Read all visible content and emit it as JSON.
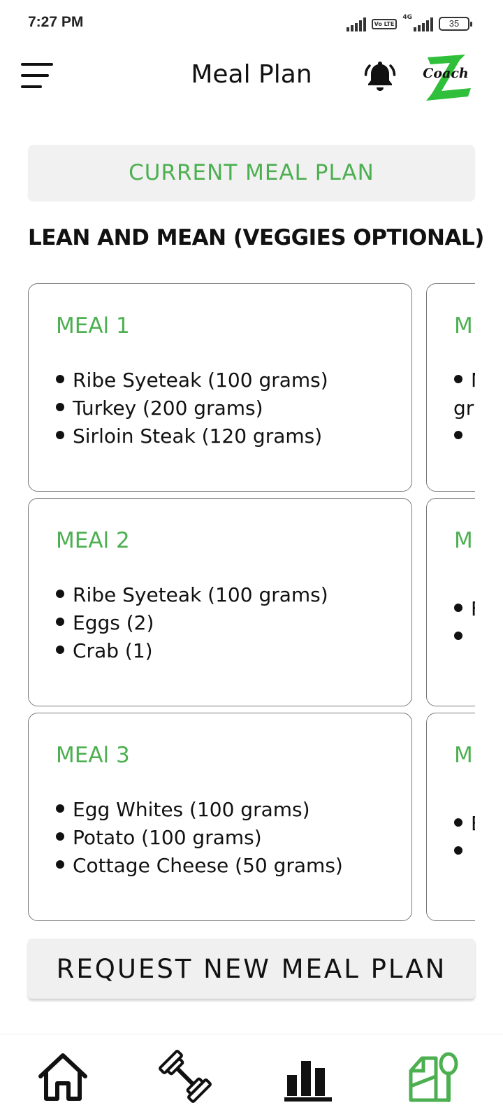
{
  "status_bar": {
    "time": "7:27 PM",
    "volte_label": "Vo LTE",
    "network_type": "4G",
    "battery_level": "35"
  },
  "header": {
    "title": "Meal Plan",
    "logo_text": "Coach"
  },
  "current_plan_button": "CURRENT MEAL PLAN",
  "plan_name": "LEAN AND MEAN (VEGGIES OPTIONAL)",
  "meals": [
    {
      "title": "MEAl 1",
      "items": [
        "Ribe Syeteak (100 grams)",
        "Turkey (200 grams)",
        "Sirloin Steak (120 grams)"
      ]
    },
    {
      "title": "MEAl 2",
      "items": [
        "Ribe Syeteak (100 grams)",
        "Eggs (2)",
        "Crab (1)"
      ]
    },
    {
      "title": "MEAl 3",
      "items": [
        "Egg Whites (100 grams)",
        "Potato (100 grams)",
        "Cottage Cheese (50 grams)"
      ]
    }
  ],
  "partial_column": {
    "titles": [
      "M",
      "M",
      "M"
    ],
    "card1_lines": [
      "N",
      "gr",
      ""
    ],
    "card2_lines": [
      "F",
      ""
    ],
    "card3_lines": [
      "E",
      ""
    ]
  },
  "request_button": "REQUEST NEW MEAL PLAN",
  "bottom_nav": {
    "items": [
      "home-icon",
      "dumbbell-icon",
      "bar-chart-icon",
      "meal-plan-icon"
    ],
    "active": "meal-plan-icon"
  },
  "colors": {
    "accent_green": "#4caf50",
    "button_bg": "#f0f0f0",
    "text": "#111111"
  }
}
